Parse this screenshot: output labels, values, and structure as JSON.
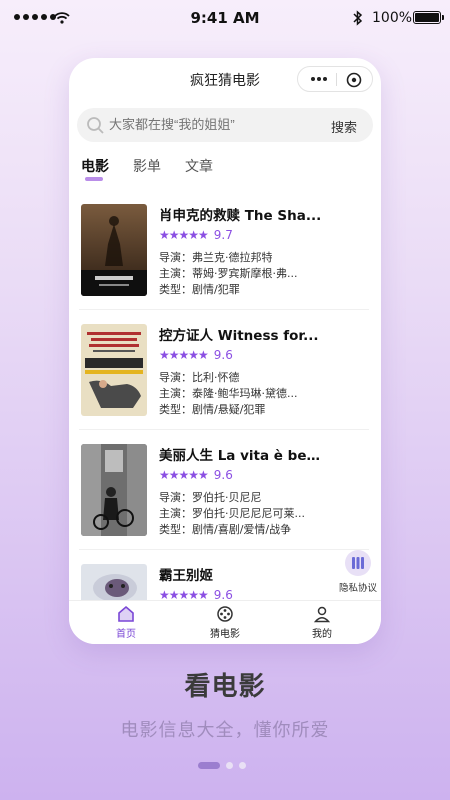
{
  "status_bar": {
    "time": "9:41 AM",
    "battery": "100%"
  },
  "nav": {
    "title": "疯狂猜电影"
  },
  "search": {
    "placeholder": "大家都在搜“我的姐姐”",
    "button": "搜索"
  },
  "tabs": [
    {
      "label": "电影",
      "active": true
    },
    {
      "label": "影单",
      "active": false
    },
    {
      "label": "文章",
      "active": false
    }
  ],
  "movies": [
    {
      "title": "肖申克的救赎 The Sha...",
      "stars": "★★★★★",
      "score": "9.7",
      "director": "导演：弗兰克·德拉邦特",
      "cast": "主演：蒂姆·罗宾斯摩根·弗...",
      "genre": "类型：剧情/犯罪"
    },
    {
      "title": "控方证人 Witness for...",
      "stars": "★★★★★",
      "score": "9.6",
      "director": "导演：比利·怀德",
      "cast": "主演：泰隆·鲍华玛琳·黛德...",
      "genre": "类型：剧情/悬疑/犯罪"
    },
    {
      "title": "美丽人生 La vita è bella",
      "stars": "★★★★★",
      "score": "9.6",
      "director": "导演：罗伯托·贝尼尼",
      "cast": "主演：罗伯托·贝尼尼尼可莱...",
      "genre": "类型：剧情/喜剧/爱情/战争"
    },
    {
      "title": "霸王别姬",
      "stars": "★★★★★",
      "score": "9.6",
      "director": "",
      "cast": "",
      "genre": ""
    }
  ],
  "privacy": {
    "label": "隐私协议"
  },
  "tabbar": [
    {
      "label": "首页",
      "active": true
    },
    {
      "label": "猜电影",
      "active": false
    },
    {
      "label": "我的",
      "active": false
    }
  ],
  "promo": {
    "title": "看电影",
    "subtitle": "电影信息大全，懂你所爱"
  },
  "colors": {
    "accent": "#8b4fe3",
    "tab_active": "#7a47d6"
  }
}
